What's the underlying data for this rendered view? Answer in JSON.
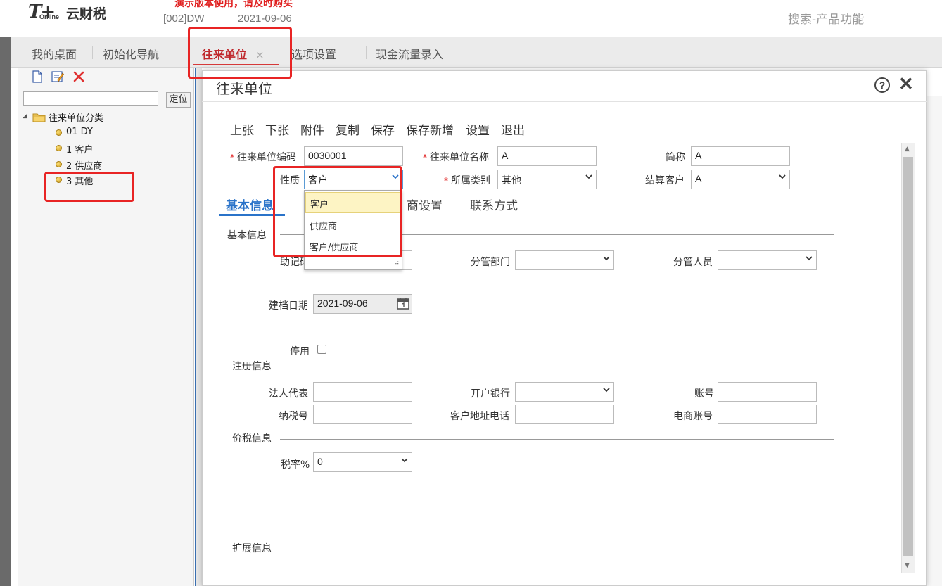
{
  "header": {
    "logo_t": "T+",
    "logo_online": "Online",
    "logo_text": "云财税",
    "demo_warning": "演示版本使用，请及时购买",
    "account": "[002]DW",
    "date": "2021-09-06",
    "search_placeholder": "搜索-产品功能"
  },
  "tabs": [
    {
      "label": "我的桌面"
    },
    {
      "label": "初始化导航"
    },
    {
      "label": "往来单位",
      "close": "×"
    },
    {
      "label": "选项设置"
    },
    {
      "label": "现金流量录入"
    }
  ],
  "left_panel": {
    "locate_button": "定位",
    "tree_root": "往来单位分类",
    "tree_items": [
      "01 DY",
      "1 客户",
      "2 供应商",
      "3 其他"
    ]
  },
  "dialog": {
    "title": "往来单位",
    "help": "?",
    "close": "✕",
    "toolbar": [
      "上张",
      "下张",
      "附件",
      "复制",
      "保存",
      "保存新增",
      "设置",
      "退出"
    ],
    "fields": {
      "code_label": "往来单位编码",
      "code_value": "0030001",
      "name_label": "往来单位名称",
      "name_value": "A",
      "short_label": "简称",
      "short_value": "A",
      "nature_label": "性质",
      "nature_value": "客户",
      "category_label": "所属类别",
      "category_value": "其他",
      "settle_label": "结算客户",
      "settle_value": "A"
    },
    "section_tabs": [
      "基本信息",
      "商设置",
      "联系方式"
    ],
    "dropdown_options": [
      "客户",
      "供应商",
      "客户/供应商"
    ],
    "basic": {
      "group": "基本信息",
      "mnemonic_label": "助记码",
      "dept_label": "分管部门",
      "person_label": "分管人员",
      "date_label": "建档日期",
      "date_value": "2021-09-06",
      "disable_label": "停用"
    },
    "register": {
      "group": "注册信息",
      "legal_label": "法人代表",
      "bank_label": "开户银行",
      "account_label": "账号",
      "tax_label": "纳税号",
      "addr_label": "客户地址电话",
      "ecom_label": "电商账号"
    },
    "price": {
      "group": "价税信息",
      "rate_label": "税率%",
      "rate_value": "0"
    },
    "ext": {
      "group": "扩展信息"
    }
  },
  "colors": {
    "accent_red": "#e82424",
    "active_tab": "#c0282c",
    "section_blue": "#2a73c9"
  }
}
